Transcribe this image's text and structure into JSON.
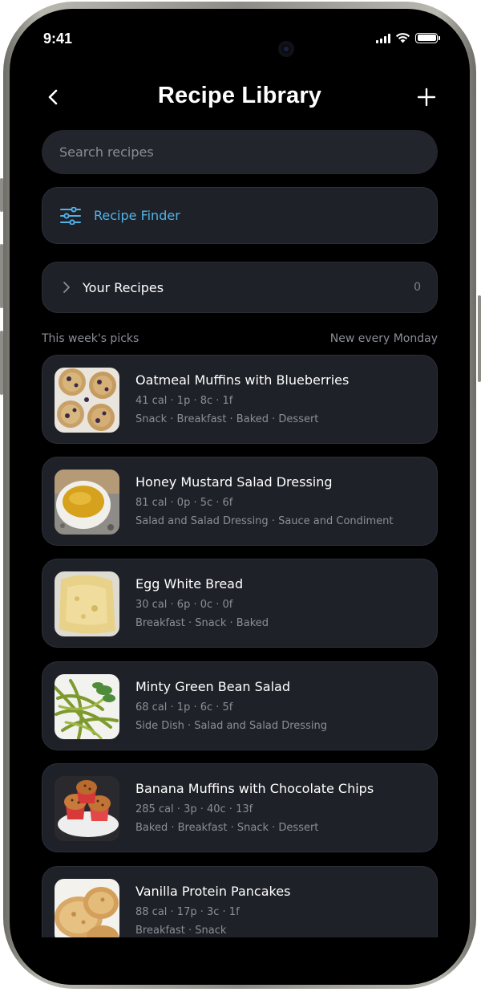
{
  "status_bar": {
    "time": "9:41"
  },
  "header": {
    "title": "Recipe Library"
  },
  "search": {
    "placeholder": "Search recipes"
  },
  "finder": {
    "label": "Recipe Finder"
  },
  "your_recipes": {
    "label": "Your Recipes",
    "count": "0"
  },
  "section": {
    "left": "This week's picks",
    "right": "New every Monday"
  },
  "recipes": [
    {
      "title": "Oatmeal Muffins with Blueberries",
      "macros": "41 cal · 1p · 8c · 1f",
      "tags": "Snack · Breakfast · Baked · Dessert"
    },
    {
      "title": "Honey Mustard Salad Dressing",
      "macros": "81 cal · 0p · 5c · 6f",
      "tags": "Salad and Salad Dressing · Sauce and Condiment"
    },
    {
      "title": "Egg White Bread",
      "macros": "30 cal · 6p · 0c · 0f",
      "tags": "Breakfast · Snack · Baked"
    },
    {
      "title": "Minty Green Bean Salad",
      "macros": "68 cal · 1p · 6c · 5f",
      "tags": "Side Dish · Salad and Salad Dressing"
    },
    {
      "title": "Banana Muffins with Chocolate Chips",
      "macros": "285 cal · 3p · 40c · 13f",
      "tags": "Baked · Breakfast · Snack · Dessert"
    },
    {
      "title": "Vanilla Protein Pancakes",
      "macros": "88 cal · 17p · 3c · 1f",
      "tags": "Breakfast · Snack"
    }
  ],
  "colors": {
    "accent": "#4fb3ea",
    "background": "#000000",
    "card": "#1f2128",
    "muted": "#8b8e97"
  },
  "icons": {
    "back": "chevron-left-icon",
    "add": "plus-icon",
    "finder": "sliders-icon",
    "expand": "chevron-right-icon"
  }
}
